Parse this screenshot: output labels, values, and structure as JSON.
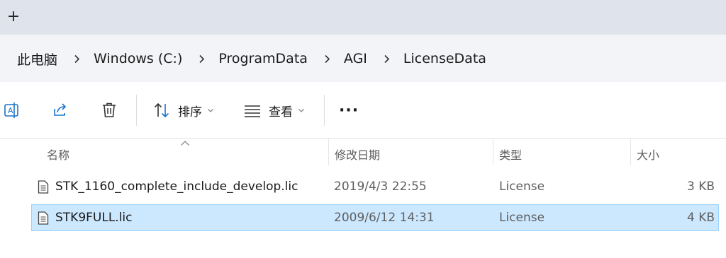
{
  "tabbar": {
    "new_tab_label": "+"
  },
  "breadcrumb": [
    "此电脑",
    "Windows (C:)",
    "ProgramData",
    "AGI",
    "LicenseData"
  ],
  "toolbar": {
    "sort_label": "排序",
    "view_label": "查看",
    "more_label": "···",
    "icons": [
      "rename-icon",
      "share-icon",
      "delete-icon",
      "sort-icon",
      "view-icon",
      "more-icon"
    ]
  },
  "columns": {
    "name": "名称",
    "date": "修改日期",
    "type": "类型",
    "size": "大小"
  },
  "files": [
    {
      "name": "STK_1160_complete_include_develop.lic",
      "date": "2019/4/3 22:55",
      "type": "License",
      "size": "3 KB",
      "selected": false
    },
    {
      "name": "STK9FULL.lic",
      "date": "2009/6/12 14:31",
      "type": "License",
      "size": "4 KB",
      "selected": true
    }
  ],
  "colors": {
    "tabbar": "#dfe3eb",
    "addressbar": "#f3f4f8",
    "selection": "#cce8ff",
    "selection_border": "#99d1ff",
    "accent": "#1a73c8"
  }
}
